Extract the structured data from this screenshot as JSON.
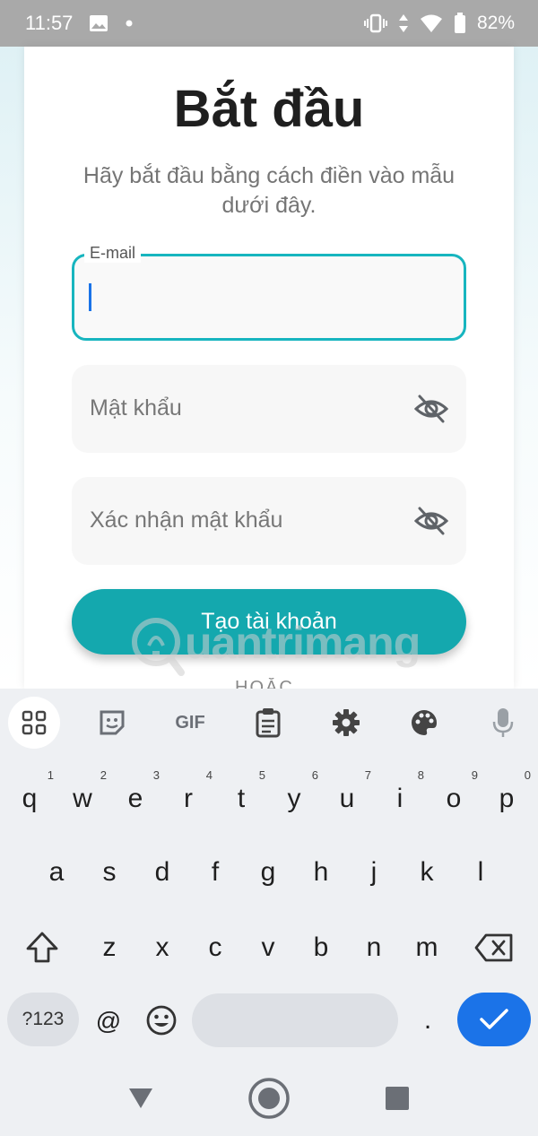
{
  "status_bar": {
    "time": "11:57",
    "battery": "82%",
    "icons": [
      "image-icon",
      "dot-icon",
      "vibrate-icon",
      "data-arrows-icon",
      "wifi-icon",
      "battery-icon"
    ]
  },
  "page": {
    "title": "Bắt đầu",
    "subtitle": "Hãy bắt đầu bằng cách điền vào mẫu dưới đây.",
    "email_label": "E-mail",
    "email_value": "",
    "password_placeholder": "Mật khẩu",
    "confirm_placeholder": "Xác nhận mật khẩu",
    "create_button": "Tạo tài khoản",
    "or_text": "HOẶC",
    "accent_color": "#17b5bf",
    "button_color": "#14a8ae"
  },
  "watermark": {
    "text": "uantrimang"
  },
  "keyboard": {
    "toolbar": {
      "items": [
        "apps-grid-icon",
        "sticker-icon",
        "gif-icon",
        "clipboard-icon",
        "settings-gear-icon",
        "palette-icon",
        "microphone-icon"
      ],
      "gif_label": "GIF"
    },
    "row1": [
      {
        "k": "q",
        "h": "1"
      },
      {
        "k": "w",
        "h": "2"
      },
      {
        "k": "e",
        "h": "3"
      },
      {
        "k": "r",
        "h": "4"
      },
      {
        "k": "t",
        "h": "5"
      },
      {
        "k": "y",
        "h": "6"
      },
      {
        "k": "u",
        "h": "7"
      },
      {
        "k": "i",
        "h": "8"
      },
      {
        "k": "o",
        "h": "9"
      },
      {
        "k": "p",
        "h": "0"
      }
    ],
    "row2": [
      "a",
      "s",
      "d",
      "f",
      "g",
      "h",
      "j",
      "k",
      "l"
    ],
    "row3": [
      "z",
      "x",
      "c",
      "v",
      "b",
      "n",
      "m"
    ],
    "symbols_key": "?123",
    "at_key": "@",
    "period_key": ".",
    "enter_color": "#1b73e8"
  },
  "nav_bar": {
    "buttons": [
      "back-triangle-icon",
      "home-circle-icon",
      "recents-square-icon"
    ]
  }
}
